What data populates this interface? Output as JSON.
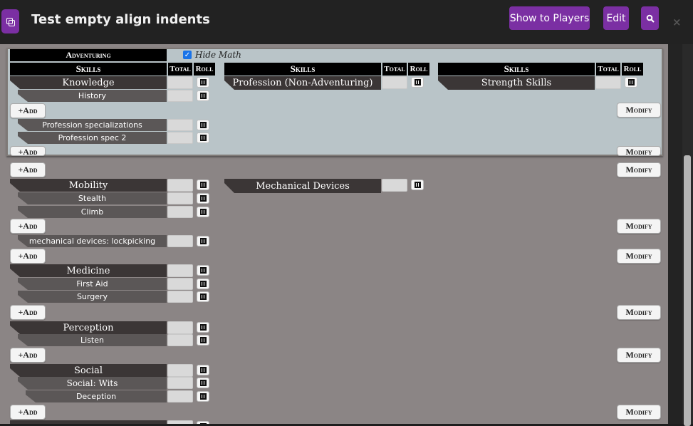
{
  "window": {
    "title": "Test empty align indents",
    "show_to_players": "Show to Players",
    "edit": "Edit",
    "close": "×"
  },
  "sheet": {
    "adventuring": "Adventuring",
    "hide_math": "Hide Math",
    "hide_math_checked": true,
    "col_skills": "Skills",
    "col_total": "Total",
    "col_roll": "Roll",
    "add": "+Add",
    "modify": "Modify",
    "skills": {
      "knowledge": "Knowledge",
      "history": "History",
      "profession_specializations": "Profession specializations",
      "profession_spec_2": "Profession spec 2",
      "profession_non_adventuring": "Profession (Non-Adventuring)",
      "strength_skills": "Strength Skills",
      "mobility": "Mobility",
      "stealth": "Stealth",
      "climb": "Climb",
      "mechanical_devices": "Mechanical Devices",
      "lockpicking": "mechanical devices: lockpicking",
      "medicine": "Medicine",
      "first_aid": "First Aid",
      "surgery": "Surgery",
      "perception": "Perception",
      "listen": "Listen",
      "social": "Social",
      "social_wits": "Social: Wits",
      "deception": "Deception"
    }
  }
}
